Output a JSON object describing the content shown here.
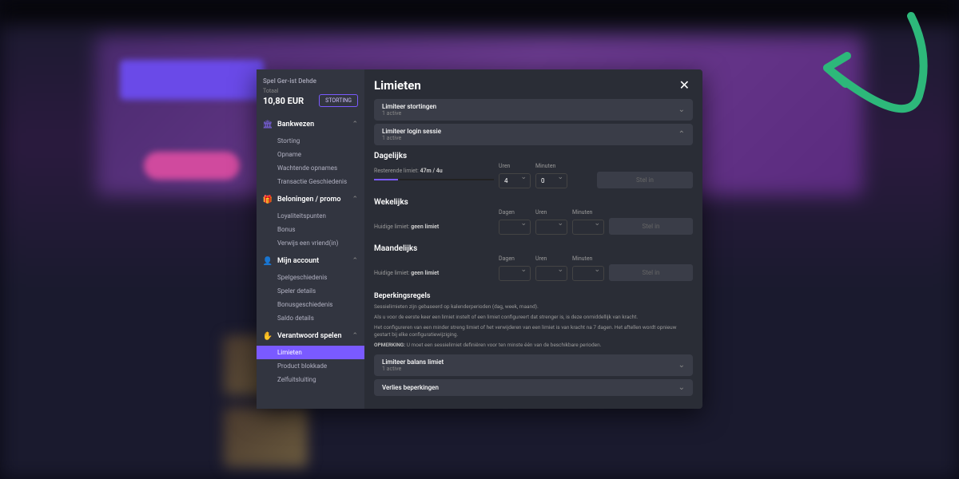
{
  "sidebar": {
    "user": "Spel Ger-ist Dehde",
    "total_label": "Totaal",
    "balance": "10,80 EUR",
    "deposit": "STORTING",
    "sections": [
      {
        "title": "Bankwezen",
        "icon": "🏛",
        "items": [
          "Storting",
          "Opname",
          "Wachtende opnames",
          "Transactie Geschiedenis"
        ]
      },
      {
        "title": "Beloningen / promo",
        "icon": "🎁",
        "items": [
          "Loyaliteitspunten",
          "Bonus",
          "Verwijs een vriend(in)"
        ]
      },
      {
        "title": "Mijn account",
        "icon": "👤",
        "items": [
          "Spelgeschiedenis",
          "Speler details",
          "Bonusgeschiedenis",
          "Saldo details"
        ]
      },
      {
        "title": "Verantwoord spelen",
        "icon": "✋",
        "items": [
          "Limieten",
          "Product blokkade",
          "Zelfuitsluiting"
        ],
        "active": 0
      }
    ]
  },
  "main": {
    "title": "Limieten",
    "panels": {
      "deposits": {
        "title": "Limiteer stortingen",
        "sub": "1 active"
      },
      "login": {
        "title": "Limiteer login sessie",
        "sub": "1 active"
      },
      "balance": {
        "title": "Limiteer balans limiet",
        "sub": "1 active"
      },
      "loss": {
        "title": "Verlies beperkingen",
        "sub": ""
      }
    },
    "daily": {
      "title": "Dagelijks",
      "sub_pre": "Resterende limiet: ",
      "sub_val": "47m / 4u",
      "hours_label": "Uren",
      "hours_val": "4",
      "min_label": "Minuten",
      "min_val": "0",
      "btn": "Stel in"
    },
    "weekly": {
      "title": "Wekelijks",
      "sub_pre": "Huidige limiet: ",
      "sub_val": "geen limiet",
      "days_label": "Dagen",
      "hours_label": "Uren",
      "min_label": "Minuten",
      "btn": "Stel in"
    },
    "monthly": {
      "title": "Maandelijks",
      "sub_pre": "Huidige limiet: ",
      "sub_val": "geen limiet",
      "days_label": "Dagen",
      "hours_label": "Uren",
      "min_label": "Minuten",
      "btn": "Stel in"
    },
    "rules": {
      "title": "Beperkingsregels",
      "r1": "Sessielimieten zijn gebaseerd op kalenderperioden (dag, week, maand).",
      "r2": "Als u voor de eerste keer een limiet instelt of een limiet configureert dat strenger is, is deze onmiddellijk van kracht.",
      "r3": "Het configureren van een minder streng limiet of het verwijderen van een limiet is van kracht na 7 dagen. Het aftellen wordt opnieuw gestart bij elke configuratiewijziging.",
      "r4_label": "OPMERKING:",
      "r4": " U moet een sessielimiet definiëren voor ten minste één van de beschikbare perioden."
    }
  }
}
